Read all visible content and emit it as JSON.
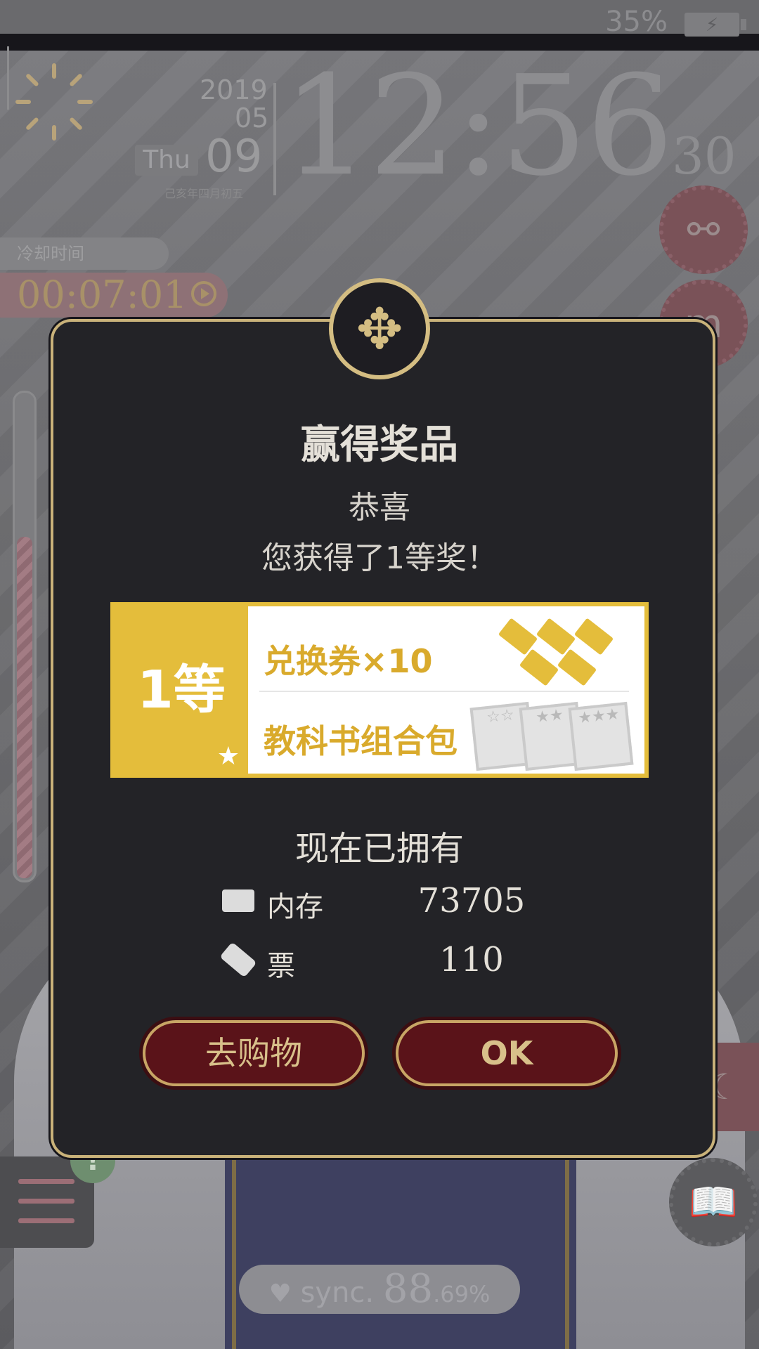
{
  "status_bar": {
    "battery_percent": "35%"
  },
  "clock": {
    "year": "2019",
    "month": "05",
    "weekday": "Thu",
    "day": "09",
    "lunar_date": "己亥年四月初五",
    "time": "12:56",
    "seconds": "30"
  },
  "cooldown": {
    "label": "冷却时间",
    "time": "00:07:01"
  },
  "gauge": {
    "level_fraction": 0.7
  },
  "dialog": {
    "title": "赢得奖品",
    "congrats": "恭喜",
    "won_message": "您获得了1等奖！",
    "prize": {
      "rank": "1等",
      "item1": "兑换券×10",
      "item2": "教科书组合包"
    },
    "owned": {
      "title": "现在已拥有",
      "rows": [
        {
          "label": "内存",
          "value": "73705",
          "icon": "memory-icon"
        },
        {
          "label": "票",
          "value": "110",
          "icon": "ticket-icon"
        }
      ]
    },
    "buttons": {
      "shop": "去购物",
      "ok": "OK"
    }
  },
  "sync": {
    "label": "sync.",
    "value_int": "88",
    "value_dec": ".69%"
  },
  "alert_badge": "!",
  "colors": {
    "dialog_bg": "#232327",
    "gold": "#e4bd3b",
    "button_red": "#5a1319",
    "border_gold": "#c9b27a"
  }
}
